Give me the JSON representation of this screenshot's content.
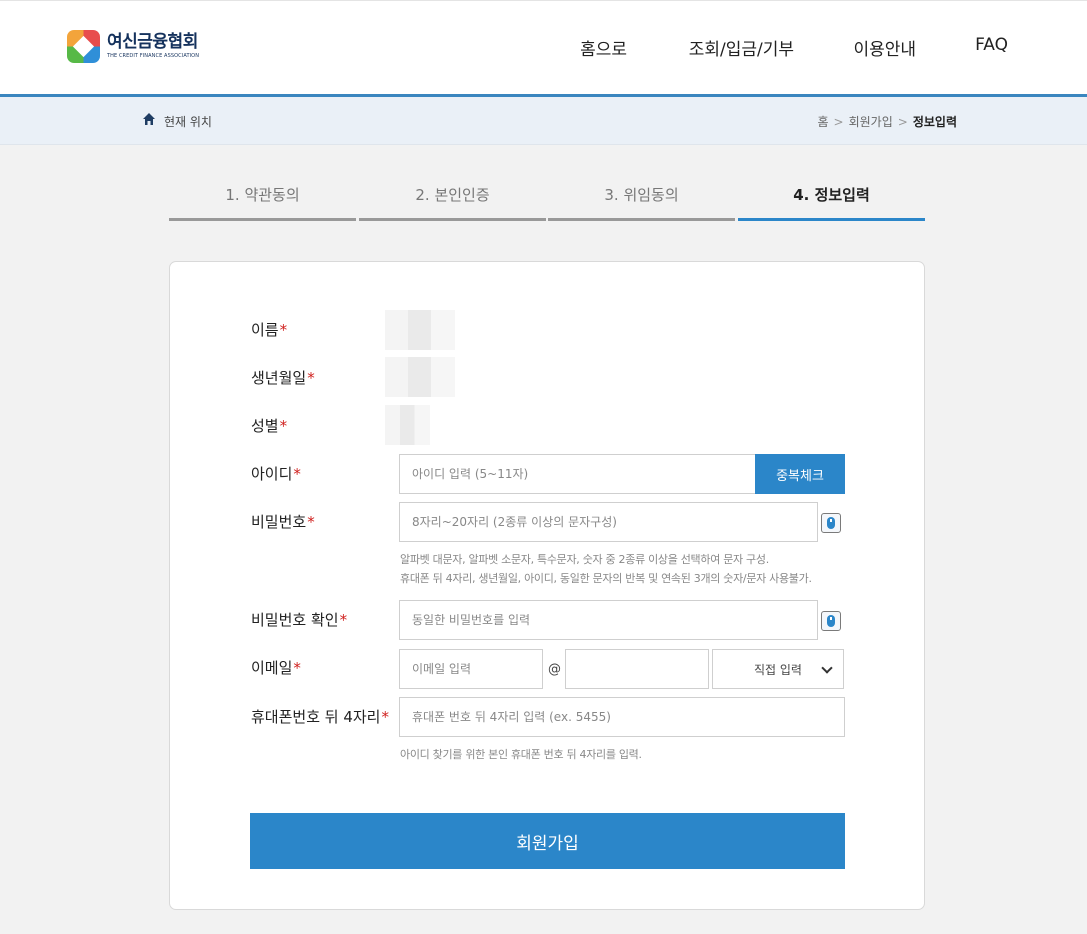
{
  "header": {
    "logo_ko": "여신금융협회",
    "logo_en": "THE CREDIT FINANCE ASSOCIATION",
    "nav": [
      "홈으로",
      "조회/입금/기부",
      "이용안내",
      "FAQ"
    ]
  },
  "location": {
    "label": "현재 위치",
    "crumbs": [
      "홈",
      "회원가입",
      "정보입력"
    ]
  },
  "steps": [
    {
      "label": "1. 약관동의",
      "active": false
    },
    {
      "label": "2. 본인인증",
      "active": false
    },
    {
      "label": "3. 위임동의",
      "active": false
    },
    {
      "label": "4. 정보입력",
      "active": true
    }
  ],
  "form": {
    "required_mark": "*",
    "name_label": "이름",
    "birth_label": "생년월일",
    "gender_label": "성별",
    "id_label": "아이디",
    "id_placeholder": "아이디 입력 (5~11자)",
    "dup_check": "중복체크",
    "pw_label": "비밀번호",
    "pw_placeholder": "8자리~20자리 (2종류 이상의 문자구성)",
    "pw_hint_1": "알파벳 대문자, 알파벳 소문자, 특수문자, 숫자 중 2종류 이상을 선택하여 문자 구성.",
    "pw_hint_2": "휴대폰 뒤 4자리, 생년월일, 아이디, 동일한 문자의 반복 및 연속된 3개의 숫자/문자 사용불가.",
    "pw_confirm_label": "비밀번호 확인",
    "pw_confirm_placeholder": "동일한 비밀번호를 입력",
    "email_label": "이메일",
    "email_placeholder": "이메일 입력",
    "email_at": "@",
    "email_domain_select": "직접 입력",
    "phone_label": "휴대폰번호 뒤 4자리",
    "phone_placeholder": "휴대폰 번호 뒤 4자리 입력 (ex. 5455)",
    "phone_hint": "아이디 찾기를 위한 본인 휴대폰 번호 뒤 4자리를 입력.",
    "submit": "회원가입"
  },
  "colors": {
    "accent": "#2b86c9",
    "required": "#d0201e",
    "header_line": "#3a86bf"
  }
}
